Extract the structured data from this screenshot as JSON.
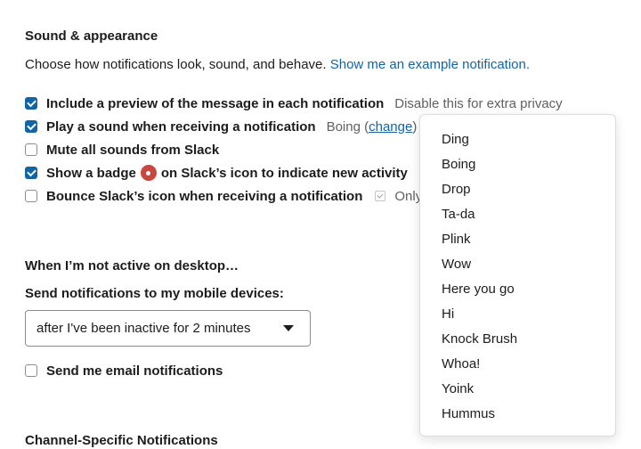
{
  "sound_section": {
    "title": "Sound & appearance",
    "intro": "Choose how notifications look, sound, and behave.",
    "example_link": "Show me an example notification."
  },
  "options": {
    "preview": {
      "label": "Include a preview of the message in each notification",
      "checked": true,
      "hint": "Disable this for extra privacy"
    },
    "sound": {
      "label": "Play a sound when receiving a notification",
      "checked": true,
      "current_sound_prefix": "Boing (",
      "change_link": "change",
      "current_sound_suffix": ")"
    },
    "mute": {
      "label": "Mute all sounds from Slack",
      "checked": false
    },
    "badge": {
      "label_before": "Show a badge",
      "label_after": "on Slack’s icon to indicate new activity",
      "checked": true
    },
    "bounce": {
      "label": "Bounce Slack’s icon when receiving a notification",
      "checked": false,
      "sub_option": "Only"
    }
  },
  "inactive_section": {
    "title": "When I’m not active on desktop…",
    "mobile_label": "Send notifications to my mobile devices:",
    "mobile_select_value": "after I've been inactive for 2 minutes",
    "email_label": "Send me email notifications",
    "email_checked": false
  },
  "channel_section": {
    "title": "Channel-Specific Notifications"
  },
  "sound_dropdown": {
    "items": [
      "Ding",
      "Boing",
      "Drop",
      "Ta-da",
      "Plink",
      "Wow",
      "Here you go",
      "Hi",
      "Knock Brush",
      "Whoa!",
      "Yoink",
      "Hummus"
    ]
  },
  "colors": {
    "link": "#1264a3",
    "checkbox_checked": "#1264a3",
    "badge": "#c9473d"
  }
}
